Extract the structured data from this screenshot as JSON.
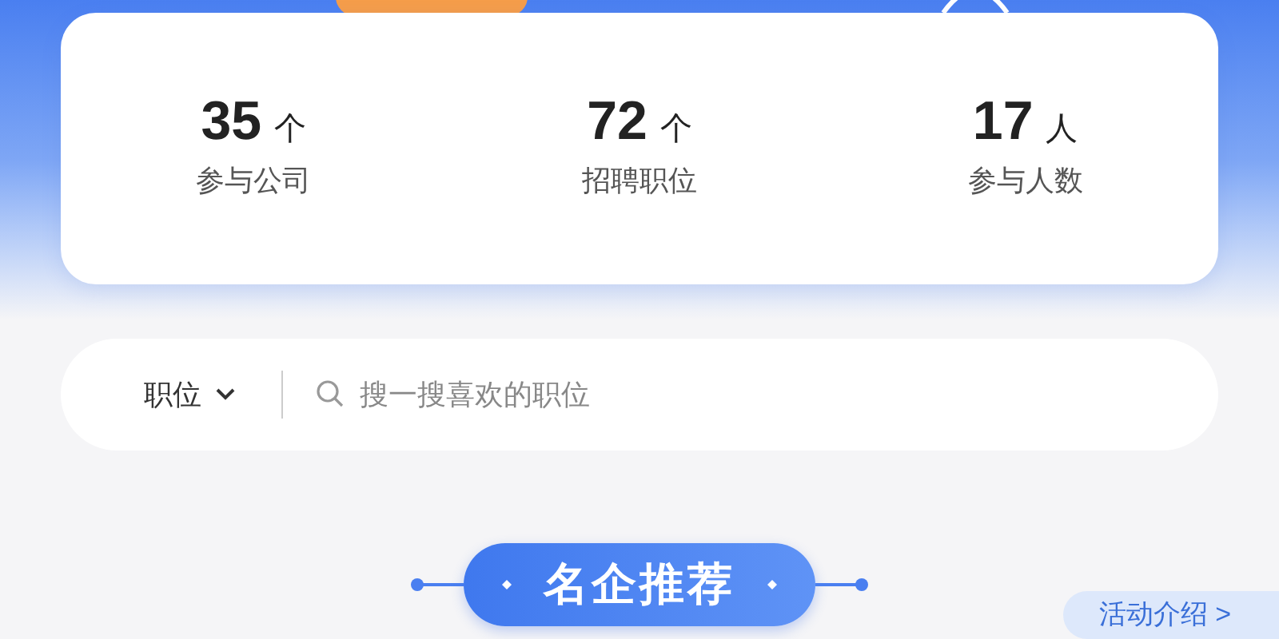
{
  "stats": [
    {
      "value": "35",
      "unit": "个",
      "label": "参与公司"
    },
    {
      "value": "72",
      "unit": "个",
      "label": "招聘职位"
    },
    {
      "value": "17",
      "unit": "人",
      "label": "参与人数"
    }
  ],
  "search": {
    "filter": "职位",
    "placeholder": "搜一搜喜欢的职位"
  },
  "section_title": "名企推荐",
  "intro_link": "活动介绍 >"
}
